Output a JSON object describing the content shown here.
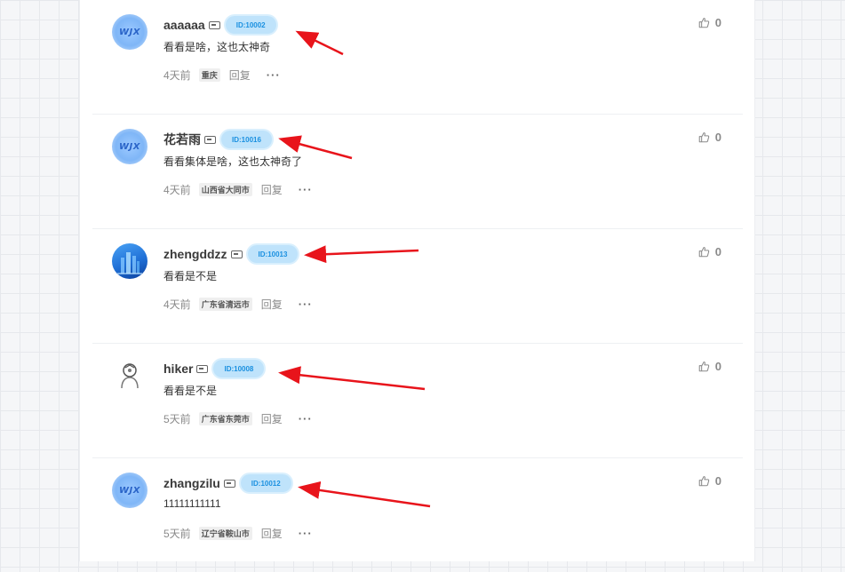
{
  "comments": [
    {
      "username": "aaaaaa",
      "id_badge": "ID:10002",
      "content": "看看是啥，这也太神奇",
      "time": "4天前",
      "location": "重庆",
      "reply_label": "回复",
      "likes": "0",
      "avatar": "wjx",
      "avatar_text": "WJX"
    },
    {
      "username": "花若雨",
      "id_badge": "ID:10016",
      "content": "看看集体是啥，这也太神奇了",
      "time": "4天前",
      "location": "山西省大同市",
      "reply_label": "回复",
      "likes": "0",
      "avatar": "wjx",
      "avatar_text": "WJX"
    },
    {
      "username": "zhengddzz",
      "id_badge": "ID:10013",
      "content": "看看是不是",
      "time": "4天前",
      "location": "广东省清远市",
      "reply_label": "回复",
      "likes": "0",
      "avatar": "city",
      "avatar_text": ""
    },
    {
      "username": "hiker",
      "id_badge": "ID:10008",
      "content": "看看是不是",
      "time": "5天前",
      "location": "广东省东莞市",
      "reply_label": "回复",
      "likes": "0",
      "avatar": "hiker",
      "avatar_text": ""
    },
    {
      "username": "zhangzilu",
      "id_badge": "ID:10012",
      "content": "11111111111",
      "time": "5天前",
      "location": "辽宁省鞍山市",
      "reply_label": "回复",
      "likes": "0",
      "avatar": "wjx",
      "avatar_text": "WJX"
    }
  ],
  "icons": {
    "like": "thumbs-up-icon",
    "more": "more-dots-icon",
    "level": "level-badge-icon"
  },
  "colors": {
    "id_badge_bg": "#bfe3fb",
    "id_badge_text": "#1a90e0",
    "annotation_arrow": "#e8141b"
  }
}
